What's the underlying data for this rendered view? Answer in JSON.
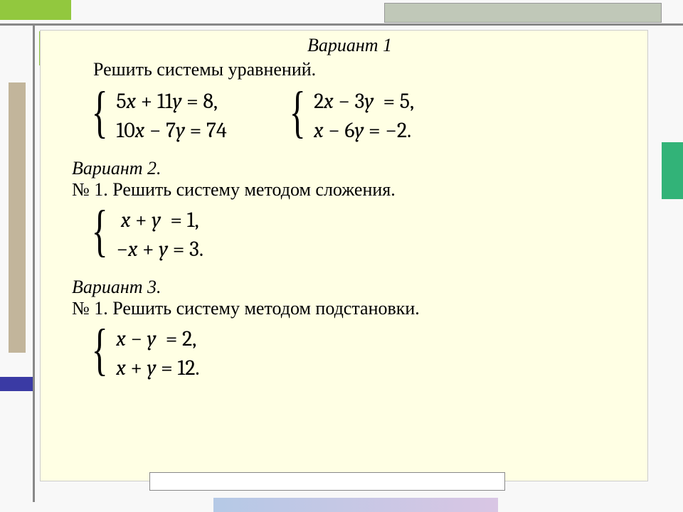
{
  "variant1": {
    "title": "Вариант 1",
    "subtitle": "Решить системы  уравнений.",
    "systems": [
      {
        "eq1": "5x + 11y = 8,",
        "eq2": "10x − 7y = 74"
      },
      {
        "eq1": "2x − 3y  = 5,",
        "eq2": "x − 6y = −2."
      }
    ]
  },
  "variant2": {
    "title": "Вариант 2.",
    "task": "№ 1. Решить систему методом сложения.",
    "system": {
      "eq1": "x + y  = 1,",
      "eq2": "−x + y = 3."
    }
  },
  "variant3": {
    "title": "Вариант 3.",
    "task": "№ 1. Решить систему методом подстановки.",
    "system": {
      "eq1": "x − y  = 2,",
      "eq2": "x + y = 12."
    }
  }
}
